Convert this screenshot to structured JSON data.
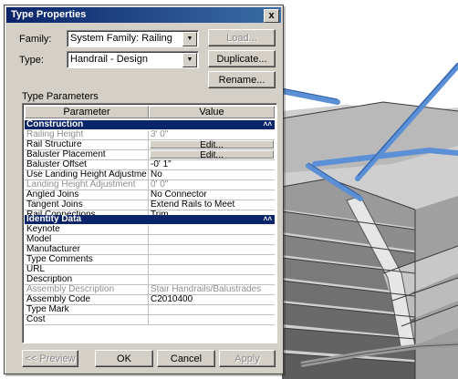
{
  "dialog": {
    "title": "Type Properties",
    "close_glyph": "x",
    "family_label": "Family:",
    "family_value": "System Family: Railing",
    "type_label": "Type:",
    "type_value": "Handrail - Design",
    "load_button": "Load...",
    "duplicate_button": "Duplicate...",
    "rename_button": "Rename...",
    "type_parameters_label": "Type Parameters",
    "columns": {
      "parameter": "Parameter",
      "value": "Value"
    },
    "collapse_glyph": "˄˄",
    "groups": {
      "construction": {
        "name": "Construction",
        "rows": [
          {
            "param": "Railing Height",
            "value": "3'  0\"",
            "dim": true
          },
          {
            "param": "Rail Structure",
            "button": "Edit..."
          },
          {
            "param": "Baluster Placement",
            "button": "Edit..."
          },
          {
            "param": "Baluster Offset",
            "value": "-0'  1\""
          },
          {
            "param": "Use Landing Height Adjustment",
            "value": "No"
          },
          {
            "param": "Landing Height Adjustment",
            "value": "0'  0\"",
            "dim": true
          },
          {
            "param": "Angled Joins",
            "value": "No Connector"
          },
          {
            "param": "Tangent Joins",
            "value": "Extend Rails to Meet"
          },
          {
            "param": "Rail Connections",
            "value": "Trim"
          }
        ]
      },
      "identity": {
        "name": "Identity Data",
        "rows": [
          {
            "param": "Keynote",
            "value": ""
          },
          {
            "param": "Model",
            "value": ""
          },
          {
            "param": "Manufacturer",
            "value": ""
          },
          {
            "param": "Type Comments",
            "value": ""
          },
          {
            "param": "URL",
            "value": ""
          },
          {
            "param": "Description",
            "value": ""
          },
          {
            "param": "Assembly Description",
            "value": "Stair Handrails/Balustrades",
            "dim": true
          },
          {
            "param": "Assembly Code",
            "value": "C2010400"
          },
          {
            "param": "Type Mark",
            "value": ""
          },
          {
            "param": "Cost",
            "value": ""
          }
        ]
      }
    },
    "buttons": {
      "preview": "<< Preview",
      "ok": "OK",
      "cancel": "Cancel",
      "apply": "Apply"
    }
  },
  "colors": {
    "title_bar": "#0a246a",
    "group_header": "#0a246a",
    "dialog_face": "#d4d0c8",
    "rail_blue": "#5b8fd6"
  }
}
